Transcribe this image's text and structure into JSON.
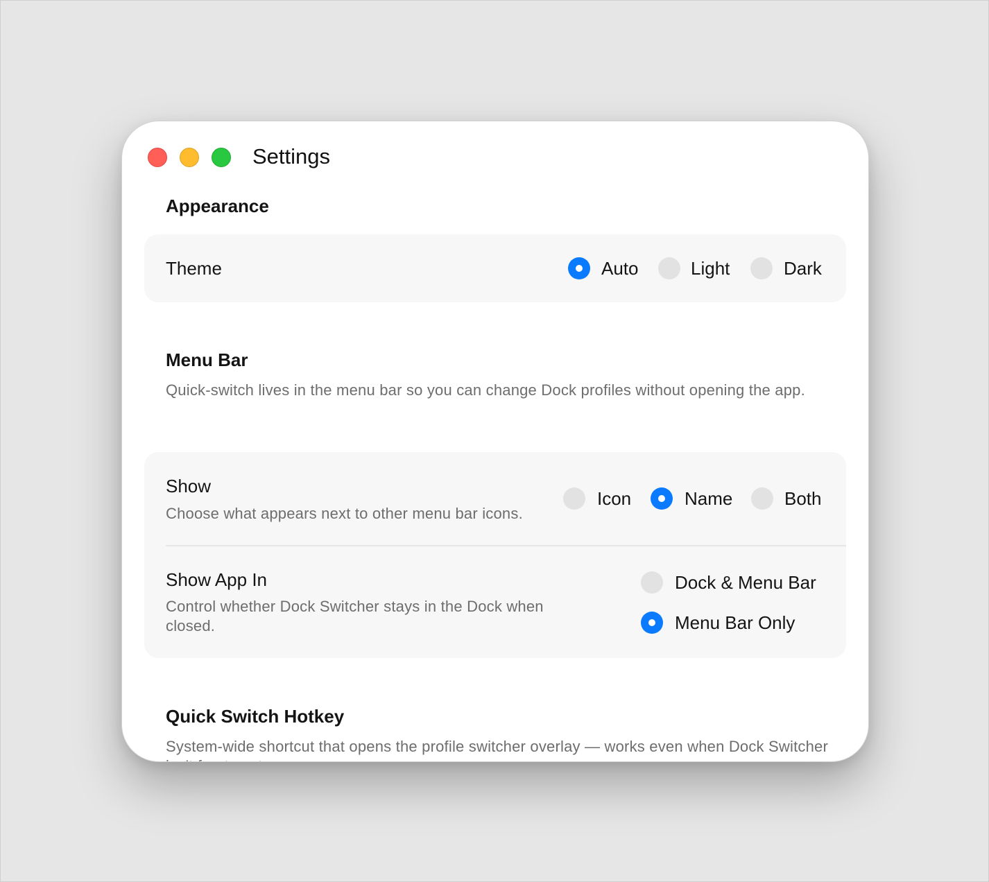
{
  "window": {
    "title": "Settings"
  },
  "appearance": {
    "title": "Appearance",
    "theme": {
      "label": "Theme",
      "options": [
        {
          "label": "Auto",
          "selected": true
        },
        {
          "label": "Light",
          "selected": false
        },
        {
          "label": "Dark",
          "selected": false
        }
      ]
    }
  },
  "menu_bar": {
    "title": "Menu Bar",
    "description": "Quick-switch lives in the menu bar so you can change Dock profiles without opening the app.",
    "show": {
      "label": "Show",
      "sublabel": "Choose what appears next to other menu bar icons.",
      "options": [
        {
          "label": "Icon",
          "selected": false
        },
        {
          "label": "Name",
          "selected": true
        },
        {
          "label": "Both",
          "selected": false
        }
      ]
    },
    "show_app_in": {
      "label": "Show App In",
      "sublabel": "Control whether Dock Switcher stays in the Dock when closed.",
      "options": [
        {
          "label": "Dock & Menu Bar",
          "selected": false
        },
        {
          "label": "Menu Bar Only",
          "selected": true
        }
      ]
    }
  },
  "hotkey": {
    "title": "Quick Switch Hotkey",
    "description": "System-wide shortcut that opens the profile switcher overlay — works even when Dock Switcher isn't frontmost."
  },
  "colors": {
    "accent": "#0a7aff",
    "close": "#ff5f57",
    "minimize": "#febc2e",
    "maximize": "#28c840"
  }
}
